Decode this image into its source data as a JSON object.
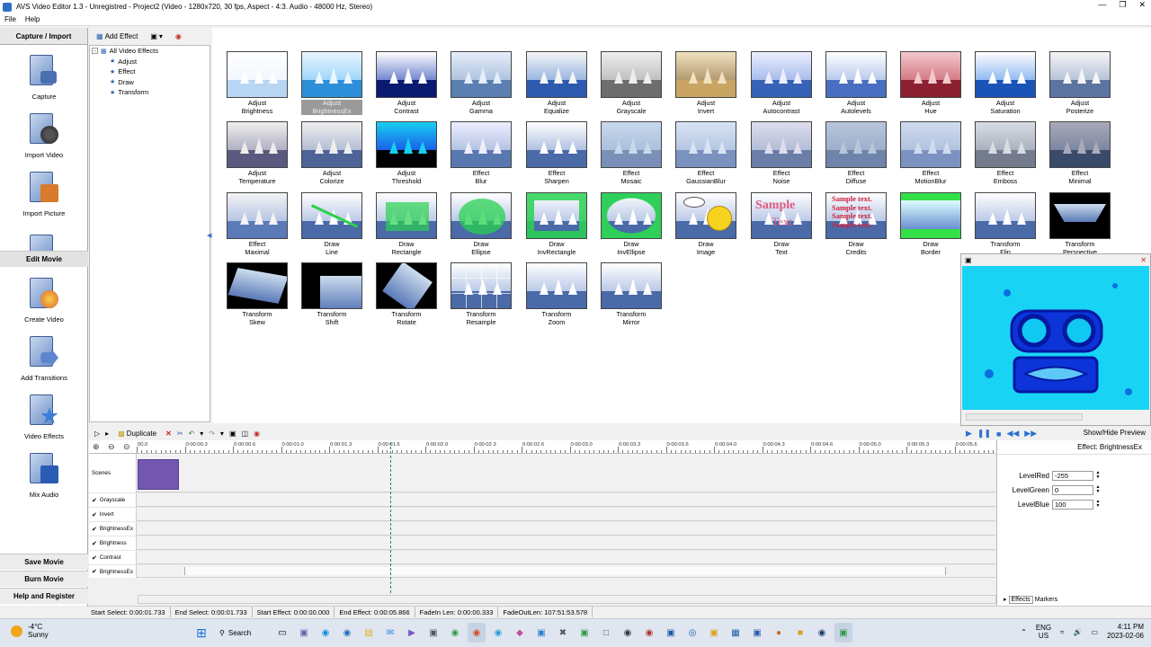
{
  "window": {
    "title": "AVS Video Editor 1.3 - Unregistred - Project2 (Video - 1280x720, 30 fps, Aspect - 4:3. Audio - 48000 Hz, Stereo)"
  },
  "menu": [
    "File",
    "Help"
  ],
  "left_panel": {
    "header": "Capture / Import",
    "items": [
      "Capture",
      "Import Video",
      "Import Picture"
    ],
    "edit_header": "Edit Movie",
    "edit_items": [
      "Create Video",
      "Add Transitions",
      "Video Effects",
      "Mix Audio"
    ],
    "bottom_buttons": [
      "Save Movie",
      "Burn Movie",
      "Help and Register"
    ]
  },
  "toolbar": {
    "add_effect": "Add Effect"
  },
  "tree": {
    "root": "All Video Effects",
    "children": [
      "Adjust",
      "Effect",
      "Draw",
      "Transform"
    ]
  },
  "effects": [
    {
      "l1": "Adjust",
      "l2": "Brightness"
    },
    {
      "l1": "Adjust",
      "l2": "BrightnessEx"
    },
    {
      "l1": "Adjust",
      "l2": "Contrast"
    },
    {
      "l1": "Adjust",
      "l2": "Gamma"
    },
    {
      "l1": "Adjust",
      "l2": "Equalize"
    },
    {
      "l1": "Adjust",
      "l2": "Grayscale"
    },
    {
      "l1": "Adjust",
      "l2": "Invert"
    },
    {
      "l1": "Adjust",
      "l2": "Autocontrast"
    },
    {
      "l1": "Adjust",
      "l2": "Autolevels"
    },
    {
      "l1": "Adjust",
      "l2": "Hue"
    },
    {
      "l1": "Adjust",
      "l2": "Saturation"
    },
    {
      "l1": "Adjust",
      "l2": "Posterize"
    },
    {
      "l1": "Adjust",
      "l2": "Temperature"
    },
    {
      "l1": "Adjust",
      "l2": "Colorize"
    },
    {
      "l1": "Adjust",
      "l2": "Threshold"
    },
    {
      "l1": "Effect",
      "l2": "Blur"
    },
    {
      "l1": "Effect",
      "l2": "Sharpen"
    },
    {
      "l1": "Effect",
      "l2": "Mosaic"
    },
    {
      "l1": "Effect",
      "l2": "GaussianBlur"
    },
    {
      "l1": "Effect",
      "l2": "Noise"
    },
    {
      "l1": "Effect",
      "l2": "Diffuse"
    },
    {
      "l1": "Effect",
      "l2": "MotionBlur"
    },
    {
      "l1": "Effect",
      "l2": "Emboss"
    },
    {
      "l1": "Effect",
      "l2": "Minimal"
    },
    {
      "l1": "Effect",
      "l2": "Maximal"
    },
    {
      "l1": "Draw",
      "l2": "Line"
    },
    {
      "l1": "Draw",
      "l2": "Rectangle"
    },
    {
      "l1": "Draw",
      "l2": "Ellipse"
    },
    {
      "l1": "Draw",
      "l2": "InvRectangle"
    },
    {
      "l1": "Draw",
      "l2": "InvEllipse"
    },
    {
      "l1": "Draw",
      "l2": "Image"
    },
    {
      "l1": "Draw",
      "l2": "Text"
    },
    {
      "l1": "Draw",
      "l2": "Credits"
    },
    {
      "l1": "Draw",
      "l2": "Border"
    },
    {
      "l1": "Transform",
      "l2": "Flip"
    },
    {
      "l1": "Transform",
      "l2": "Perspective"
    },
    {
      "l1": "Transform",
      "l2": "Skew"
    },
    {
      "l1": "Transform",
      "l2": "Shift"
    },
    {
      "l1": "Transform",
      "l2": "Rotate"
    },
    {
      "l1": "Transform",
      "l2": "Resample"
    },
    {
      "l1": "Transform",
      "l2": "Zoom"
    },
    {
      "l1": "Transform",
      "l2": "Mirror"
    }
  ],
  "thumb_text": {
    "sample": "Sample",
    "text": "Text",
    "credits": "Sample text."
  },
  "timeline_toolbar": {
    "duplicate": "Duplicate"
  },
  "ruler_ticks": [
    "00.0",
    "0:00:00.3",
    "0:00:00.6",
    "0:00:01.0",
    "0:00:01.3",
    "0:00:01.6",
    "0:00:02.0",
    "0:00:02.3",
    "0:00:02.6",
    "0:00:03.0",
    "0:00:03.3",
    "0:00:03.6",
    "0:00:04.0",
    "0:00:04.3",
    "0:00:04.6",
    "0:00:05.0",
    "0:00:05.3",
    "0:00:05.6"
  ],
  "tracks": [
    {
      "name": "Scenes",
      "checked": false
    },
    {
      "name": "Grayscale",
      "checked": true
    },
    {
      "name": "Invert",
      "checked": true
    },
    {
      "name": "BrightnessEx",
      "checked": true
    },
    {
      "name": "Brightness",
      "checked": true
    },
    {
      "name": "Contrast",
      "checked": true
    },
    {
      "name": "BrightnessEx",
      "checked": true
    }
  ],
  "preview": {
    "show_hide": "Show/Hide Preview"
  },
  "properties": {
    "title": "Effect: BrightnessEx",
    "fields": [
      {
        "label": "LevelRed",
        "value": "-255"
      },
      {
        "label": "LevelGreen",
        "value": "0"
      },
      {
        "label": "LevelBlue",
        "value": "100"
      }
    ],
    "tabs": [
      "Effects",
      "Markers"
    ]
  },
  "status": [
    "Start Select: 0:00:01.733",
    "End Select: 0:00:01.733",
    "Start Effect: 0:00:00.000",
    "End Effect: 0:00:05.866",
    "FadeIn Len: 0:00:00.333",
    "FadeOutLen: 107:51:53.578"
  ],
  "taskbar": {
    "weather_temp": "-4°C",
    "weather_desc": "Sunny",
    "search": "Search",
    "lang": "ENG",
    "region": "US",
    "time": "4:11 PM",
    "date": "2023-02-06"
  },
  "colors": {
    "accent": "#2a6fd0",
    "scene_clip": "#7356b0",
    "preview_bg": "#19d3f5"
  }
}
